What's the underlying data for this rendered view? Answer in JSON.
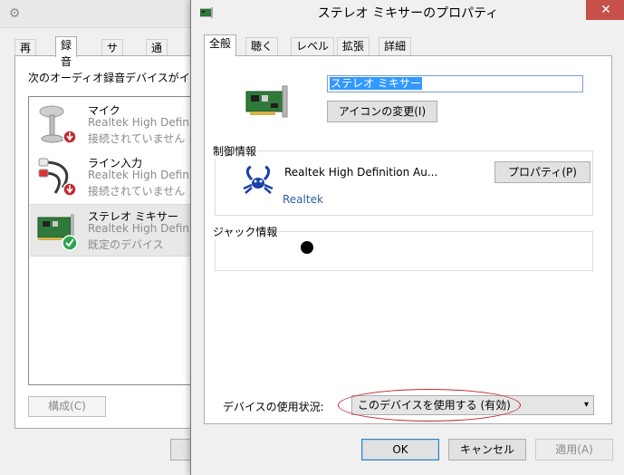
{
  "sound_dialog": {
    "title_icon": "speaker-icon",
    "tabs": [
      "再生",
      "録音",
      "サウンド",
      "通信"
    ],
    "active_tab": "録音",
    "instruction": "次のオーディオ録音デバイスがインストー",
    "devices": [
      {
        "name": "マイク",
        "driver": "Realtek High Definit",
        "status": "接続されていません",
        "icon": "microphone-icon",
        "badge": "disconnected-badge"
      },
      {
        "name": "ライン入力",
        "driver": "Realtek High Definit",
        "status": "接続されていません",
        "icon": "rca-cable-icon",
        "badge": "disconnected-badge"
      },
      {
        "name": "ステレオ ミキサー",
        "driver": "Realtek High Definit",
        "status": "既定のデバイス",
        "icon": "sound-card-icon",
        "badge": "default-check-badge"
      }
    ],
    "configure_label": "構成(C)"
  },
  "properties_dialog": {
    "title": "ステレオ ミキサーのプロパティ",
    "close_label": "✕",
    "tabs": [
      "全般",
      "聴く",
      "レベル",
      "拡張",
      "詳細"
    ],
    "active_tab": "全般",
    "device_name_value": "ステレオ ミキサー",
    "change_icon_label": "アイコンの変更(I)",
    "controller_group_label": "制御情報",
    "controller_name": "Realtek High Definition Au...",
    "controller_vendor": "Realtek",
    "properties_button_label": "プロパティ(P)",
    "jack_group_label": "ジャック情報",
    "usage_label": "デバイスの使用状況:",
    "usage_value": "このデバイスを使用する (有効)",
    "ok_label": "OK",
    "cancel_label": "キャンセル",
    "apply_label": "適用(A)"
  },
  "colors": {
    "close_button": "#c7504b",
    "selection": "#3399ff",
    "highlight_ellipse": "#c0282d",
    "vendor_link": "#2a5ea8"
  }
}
